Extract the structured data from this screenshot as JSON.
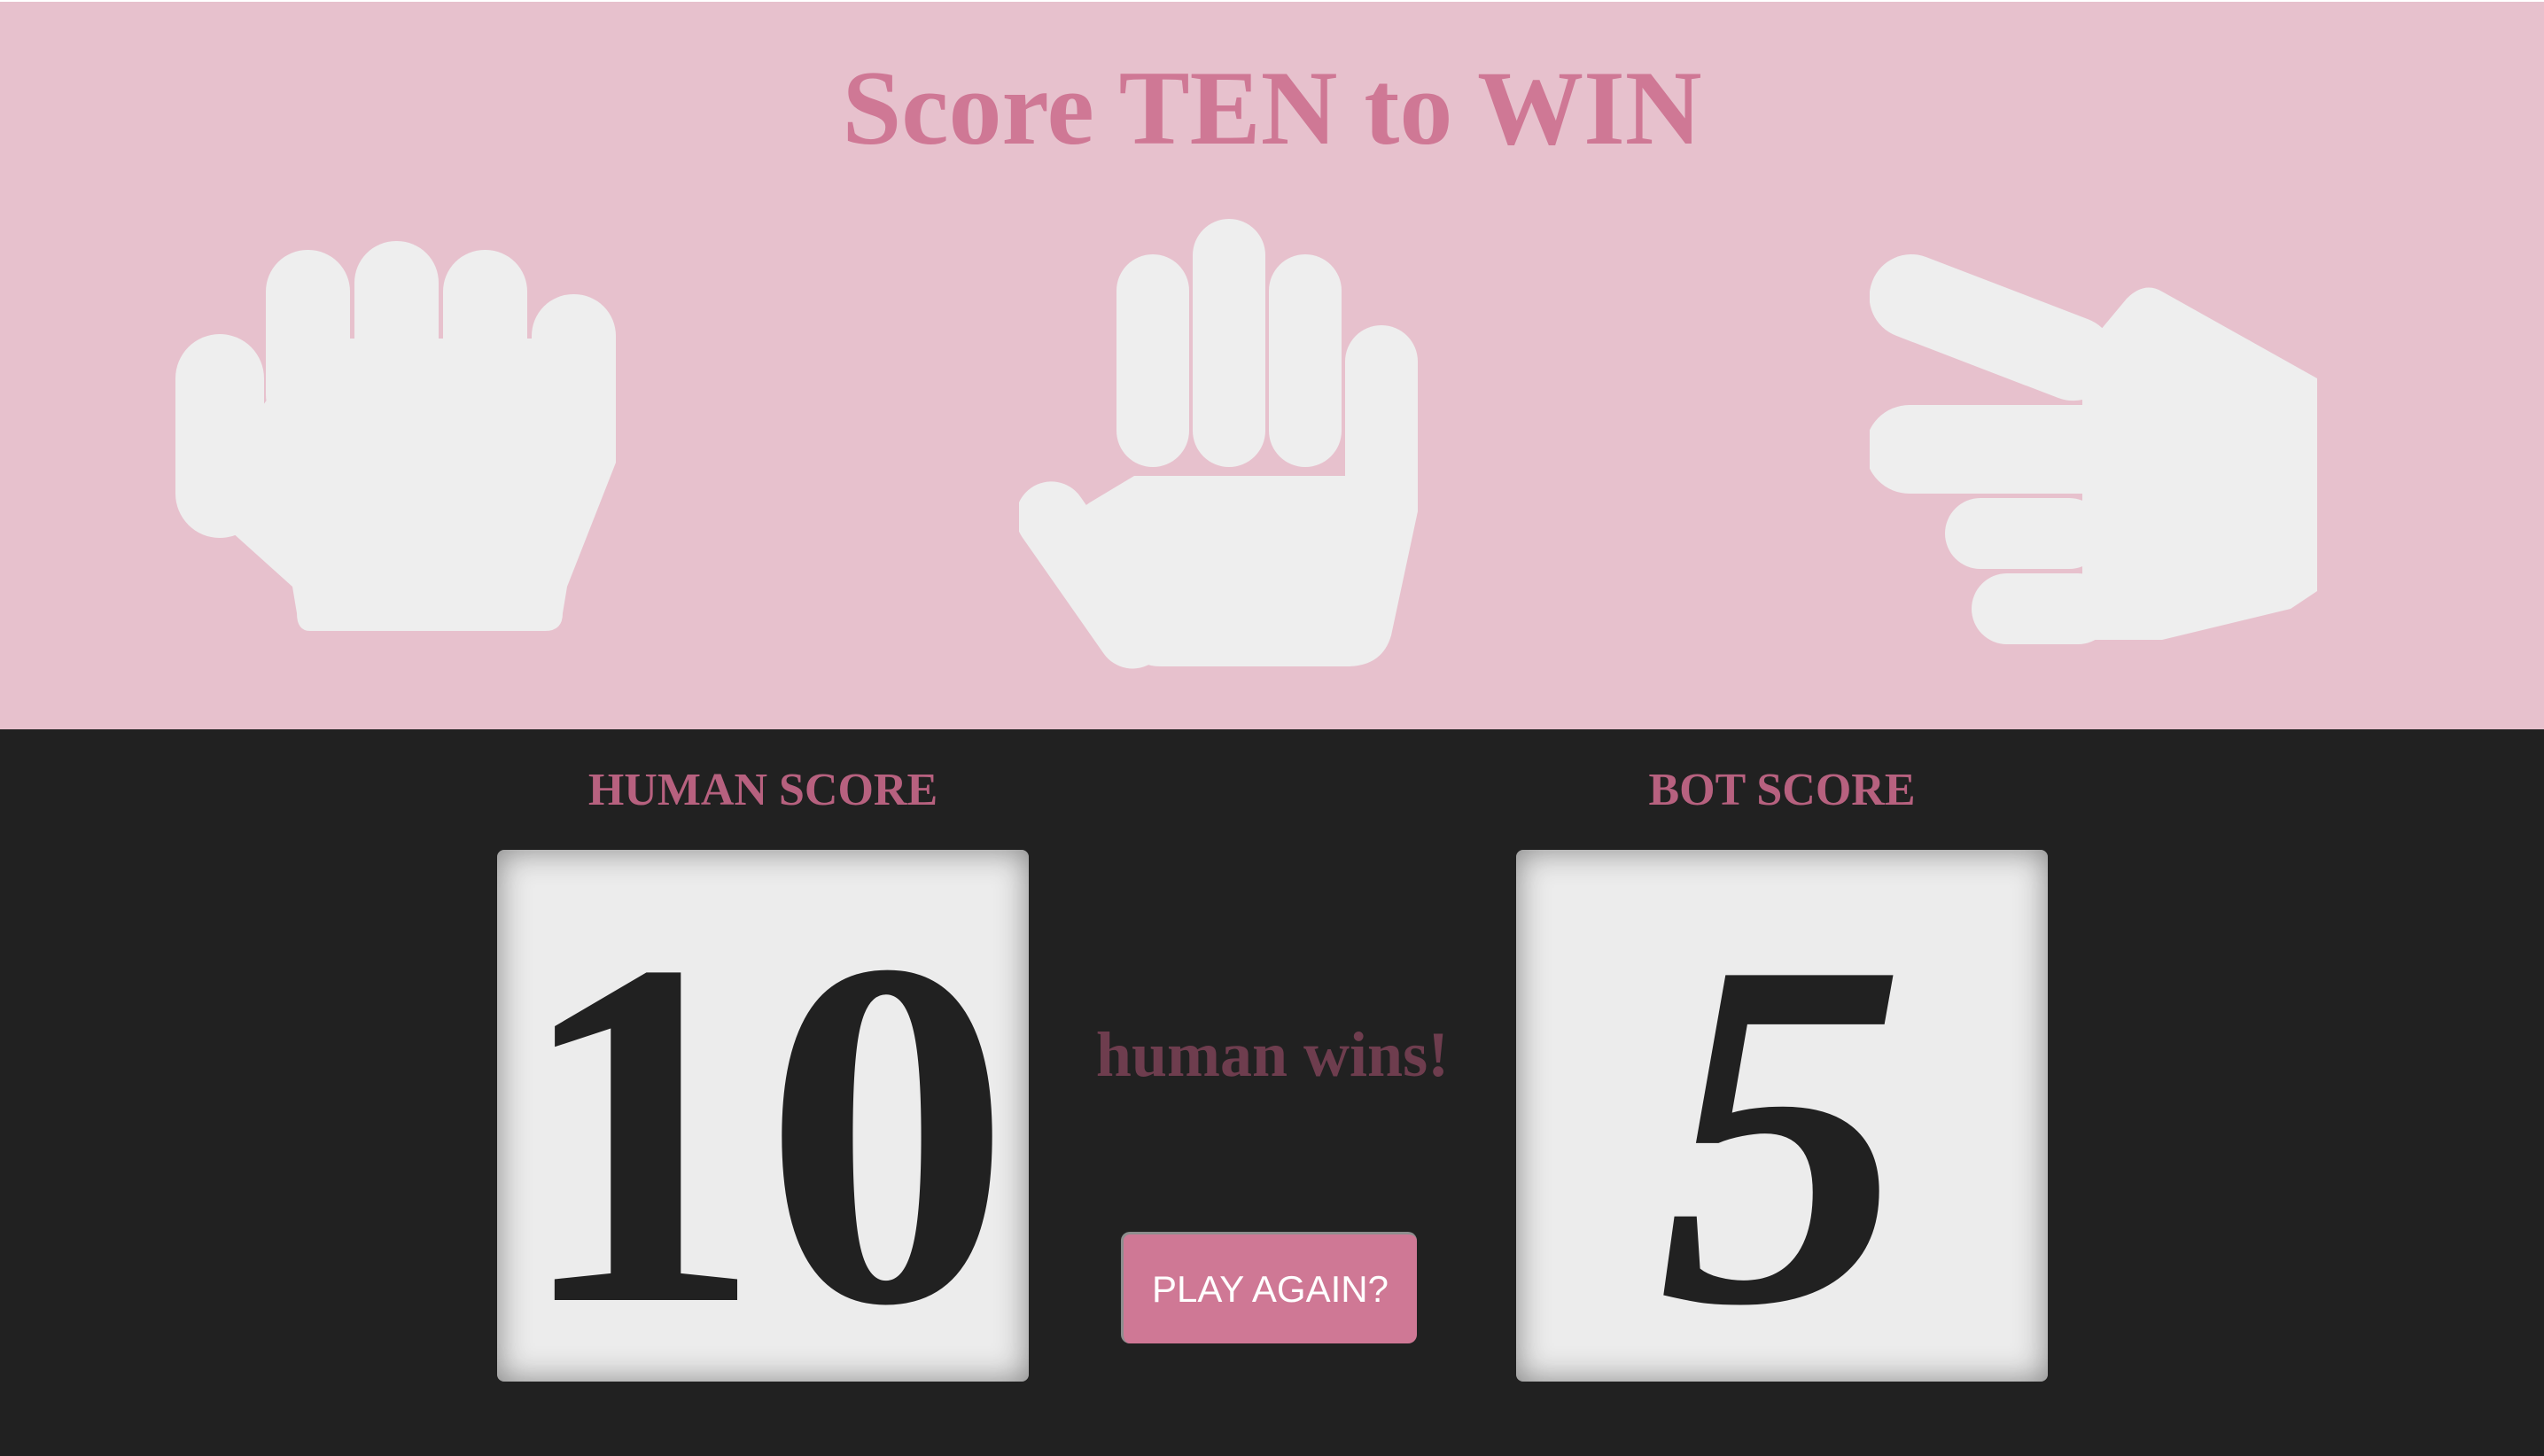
{
  "header": {
    "title": "Score TEN to WIN"
  },
  "choices": [
    {
      "id": "rock",
      "icon": "hand-rock-icon"
    },
    {
      "id": "paper",
      "icon": "hand-paper-icon"
    },
    {
      "id": "scissors",
      "icon": "hand-scissors-icon"
    }
  ],
  "scoreboard": {
    "human_label": "HUMAN SCORE",
    "human_score": "10",
    "bot_label": "BOT SCORE",
    "bot_score": "5",
    "result_text": "human wins!",
    "play_again_label": "PLAY AGAIN?"
  },
  "colors": {
    "top_background": "#e7c1cd",
    "accent": "#cf7895",
    "bottom_background": "#212121",
    "icon_fill": "#eeeeee",
    "score_box": "#ececec"
  }
}
